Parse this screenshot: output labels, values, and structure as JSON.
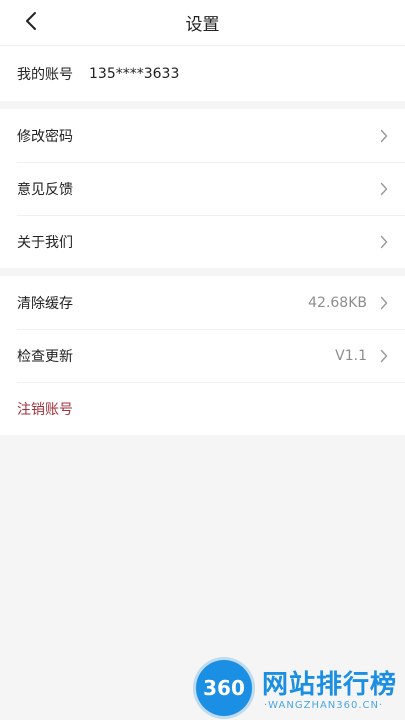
{
  "header": {
    "title": "设置"
  },
  "account": {
    "label": "我的账号",
    "value": "135****3633"
  },
  "group1": [
    {
      "label": "修改密码"
    },
    {
      "label": "意见反馈"
    },
    {
      "label": "关于我们"
    }
  ],
  "group2": {
    "cache": {
      "label": "清除缓存",
      "value": "42.68KB"
    },
    "update": {
      "label": "检查更新",
      "value": "V1.1"
    },
    "delete": {
      "label": "注销账号"
    }
  },
  "watermark": {
    "badge": "360",
    "title": "网站排行榜",
    "subtitle": "·WANGZHAN360.CN·"
  },
  "colors": {
    "danger": "#a0323b",
    "watermark": "#1a8fe3"
  },
  "icons": {
    "back": "chevron-left-icon",
    "row": "chevron-right-icon"
  }
}
